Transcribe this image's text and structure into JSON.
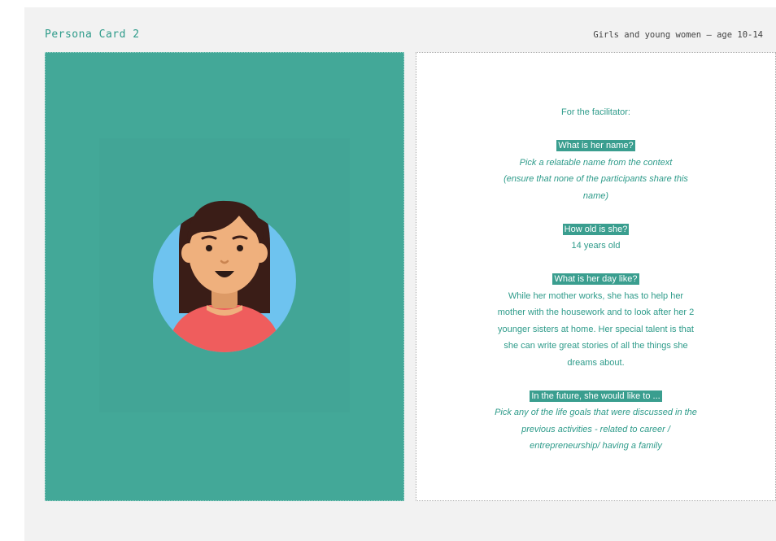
{
  "header": {
    "title": "Persona Card 2",
    "subtitle": "Girls and young women – age 10-14"
  },
  "avatar": {
    "icon": "girl-avatar-icon",
    "colors": {
      "background": "#43a898",
      "circle": "#6ec3ef",
      "hair": "#3a1d17",
      "skin": "#efb07d",
      "shirt": "#ef5d5d"
    }
  },
  "facilitator": {
    "intro": "For the facilitator:",
    "sections": [
      {
        "question": "What is her name?",
        "answer_lines": [
          "Pick a relatable name from the context",
          "(ensure that none of the participants share this",
          "name)"
        ]
      },
      {
        "question": "How old is she?",
        "answer_lines": [
          "14 years old"
        ]
      },
      {
        "question": "What is her day like?",
        "answer_lines": [
          "While her mother works, she has to help her",
          "mother with the housework and to look after her 2",
          "younger sisters at home. Her special talent is that",
          "she can write great stories of all the things she",
          "dreams about."
        ]
      },
      {
        "question": "In the future, she would like to ...",
        "answer_lines": [
          "Pick any of the life goals that were discussed in the",
          "previous activities - related to career /",
          "entrepreneurship/ having a family"
        ]
      }
    ]
  }
}
